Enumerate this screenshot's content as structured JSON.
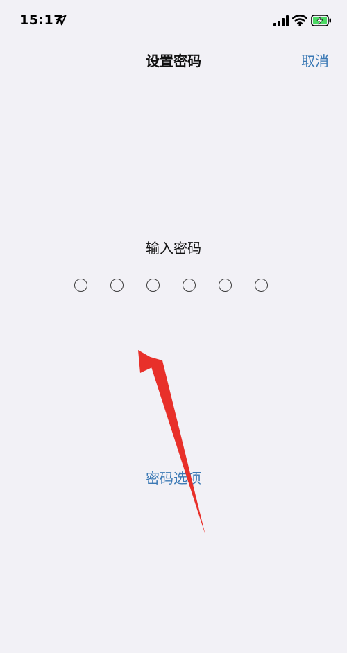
{
  "status_bar": {
    "time": "15:17",
    "location_icon": "location-arrow-icon",
    "signal_icon": "cellular-signal-icon",
    "wifi_icon": "wifi-icon",
    "battery_icon": "battery-charging-icon"
  },
  "nav": {
    "title": "设置密码",
    "cancel_label": "取消"
  },
  "passcode": {
    "prompt": "输入密码",
    "digit_count": 6,
    "filled_count": 0
  },
  "options": {
    "label": "密码选项"
  },
  "colors": {
    "background": "#f2f1f6",
    "accent": "#3b79b5",
    "annotation_arrow": "#e8302a",
    "battery_fill": "#4cd964"
  }
}
